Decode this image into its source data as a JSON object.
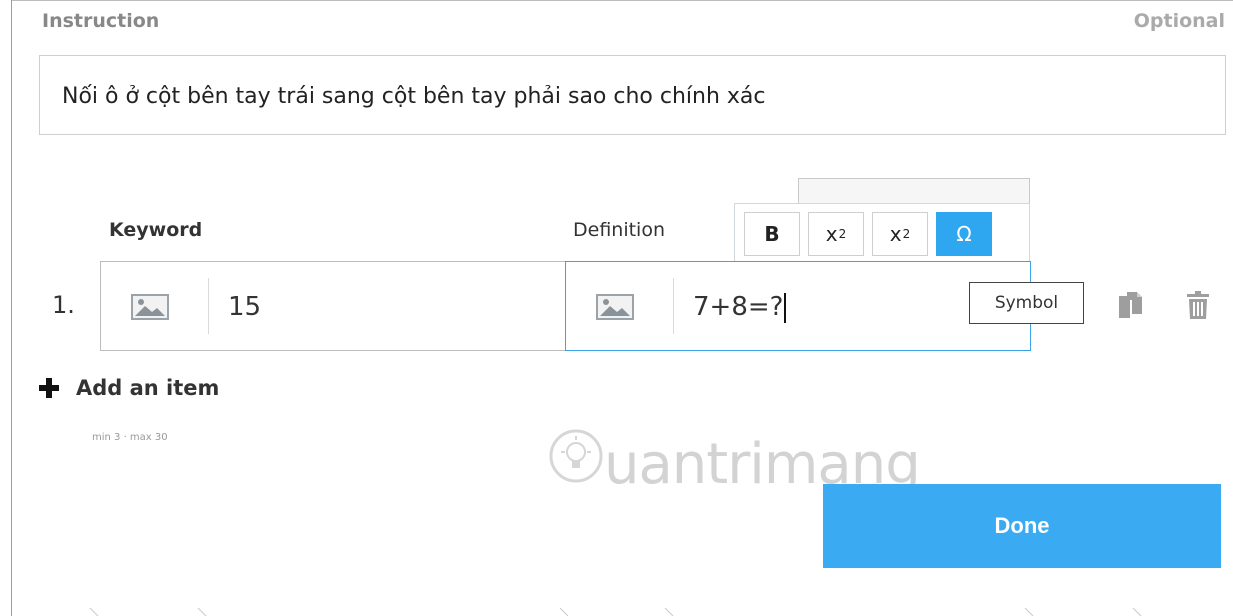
{
  "instruction": {
    "label": "Instruction",
    "optional_label": "Optional",
    "text": "Nối ô ở cột bên tay trái sang cột bên tay phải sao cho chính xác"
  },
  "columns": {
    "keyword_label": "Keyword",
    "definition_label": "Definition"
  },
  "toolbar": {
    "bold_label": "B",
    "superscript_base": "x",
    "superscript_exp": "2",
    "subscript_base": "x",
    "subscript_sub": "2",
    "symbol_label": "Ω",
    "symbol_tooltip": "Symbol"
  },
  "items": [
    {
      "number": "1.",
      "keyword": "15",
      "definition": "7+8=?"
    }
  ],
  "add_item": {
    "label": "Add an item",
    "limits": "min 3 · max 30"
  },
  "watermark": "uantrimang",
  "done_label": "Done",
  "colors": {
    "accent": "#3aaaf2",
    "active_border": "#3aa4e6"
  }
}
